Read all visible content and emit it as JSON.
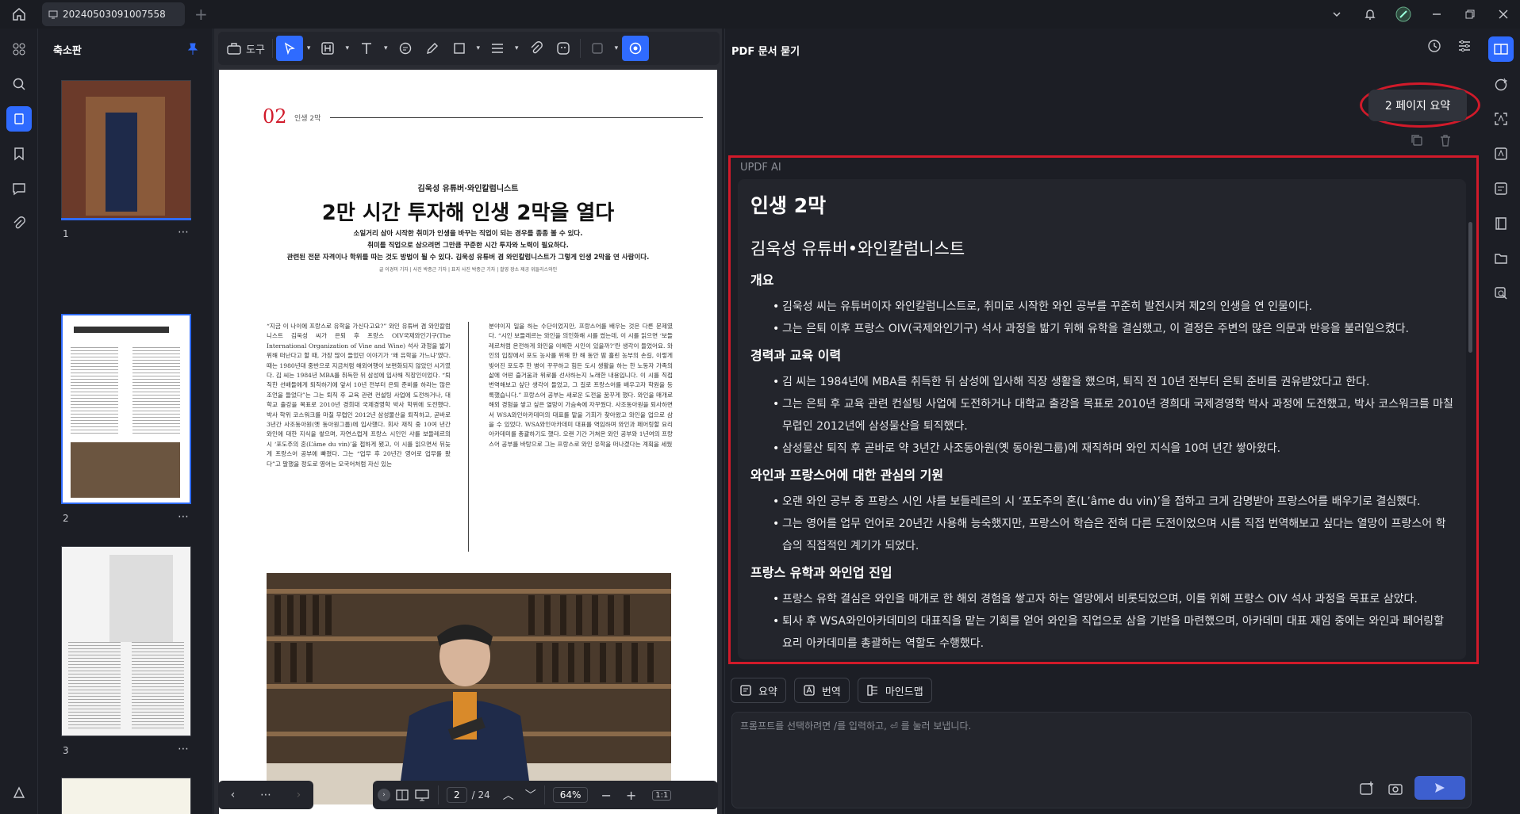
{
  "titlebar": {
    "tab_title": "20240503091007558"
  },
  "thumbnails": {
    "header": "축소판",
    "pages": [
      {
        "num": "1",
        "more": "⋯"
      },
      {
        "num": "2",
        "more": "⋯"
      },
      {
        "num": "3",
        "more": "⋯"
      }
    ]
  },
  "toolbar": {
    "tools_label": "도구"
  },
  "page": {
    "section_number": "02",
    "section_name": "인생 2막",
    "kicker": "김욱성 유튜버·와인칼럼니스트",
    "title": "2만 시간 투자해 인생 2막을 열다",
    "lead_1": "소일거리 삼아 시작한 취미가 인생을 바꾸는 직업이 되는 경우를 종종 볼 수 있다.",
    "lead_2": "취미를 직업으로 삼으려면 그만큼 꾸준한 시간 투자와 노력이 필요하다.",
    "lead_3": "관련된 전문 자격이나 학위를 따는 것도 방법이 될 수 있다. 김욱성 유튜버 겸 와인칼럼니스트가 그렇게 인생 2막을 연 사람이다.",
    "credit": "글 이경미 기자 | 사진 박종근 기자 | 표지 사진 박종근 기자 | 촬영 장소 제공 위들리스와인",
    "col_left": "“지금 이 나이에 프랑스로 유학을 가신다고요?” 와인 유튜버 겸 와인칼럼니스트 김욱성 씨가 은퇴 후 프랑스 OIV국제와인기구(The International Organization of Vine and Wine) 석사 과정을 밟기 위해 떠난다고 할 때, 가장 많이 들었던 이야기가 ‘왜 유학을 가느냐’였다. 때는 1980년대 중반으로 지금처럼 해외여행이 보편화되지 않았던 시기였다. 김 씨는 1984년 MBA를 취득한 뒤 삼성에 입사해 직장인이었다. “퇴직한 선배들에게 퇴직하기에 앞서 10년 전부터 은퇴 준비를 하라는 많은 조언을 들었다”는 그는 퇴직 후 교육 관련 컨설팅 사업에 도전하거나, 대학교 출강을 목표로 2010년 경희대 국제경영학 박사 학위에 도전했다. 박사 학위 코스워크를 마칠 무렵인 2012년 삼성물산을 퇴직하고, 곧바로 3년간 사조동아원(옛 동아원그룹)에 입사했다. 회사 재직 중 10여 년간 와인에 대한 지식을 쌓으며, 자연스럽게 프랑스 시인인 샤를 보들레르의 시 ‘포도주의 혼(L’âme du vin)’을 접하게 됐고, 이 시를 읽으면서 뒤늦게 프랑스어 공부에 빠졌다. 그는 “업무 후 20년간 영어로 업무를 봤다”고 말했을 정도로 영어는 모국어처럼 자신 있는",
    "col_right": "분야이지 일을 하는 수단이었지만, 프랑스어를 배우는 것은 다른 문제였다. “시인 보들레르는 와인을 의인화해 시를 썼는데, 이 시를 읽으면 ‘보들레르처럼 온전하게 와인을 이해한 시인이 있을까?’란 생각이 들었어요. 와인의 입장에서 포도 농사를 위해 한 해 동안 땀 흘린 농부의 손길, 이렇게 빚어진 포도주 한 병이 꾸꾸하고 힘든 도시 생활을 하는 한 노동자 가족의 삶에 어떤 즐거움과 위로를 선사하는지 노래한 내용입니다. 이 시를 직접 번역해보고 싶단 생각이 들었고, 그 길로 프랑스어를 배우고자 학원을 등록했습니다.” 프랑스어 공부는 새로운 도전을 꿈꾸게 했다. 와인을 매개로 해외 경험을 쌓고 싶은 열망이 가슴속에 자꾸웠다. 사조동아원을 퇴사하면서 WSA와인아카데미의 대표를 맡을 기회가 찾아왔고 와인을 업으로 삼을 수 있었다. WSA와인아카데미 대표를 역임하며 와인과 페어링할 요리 아카데미를 총괄하기도 했다. 오랜 기간 거쳐온 와인 공부와 1년여의 프랑스어 공부를 바탕으로 그는 프랑스로 와인 유학을 떠나겠다는 계획을 세웠"
  },
  "bottombar": {
    "page_current": "2",
    "page_total": "/ 24",
    "zoom": "64%",
    "fit": "1:1"
  },
  "ai_panel": {
    "title": "PDF 문서 묻기",
    "summary_button": "2 페이지 요약",
    "ai_label": "UPDF AI",
    "h1": "인생 2막",
    "h2": "김욱성 유튜버•와인칼럼니스트",
    "sections": [
      {
        "heading": "개요",
        "items": [
          "김욱성 씨는 유튜버이자 와인칼럼니스트로, 취미로 시작한 와인 공부를 꾸준히 발전시켜 제2의 인생을 연 인물이다.",
          "그는 은퇴 이후 프랑스 OIV(국제와인기구) 석사 과정을 밟기 위해 유학을 결심했고, 이 결정은 주변의 많은 의문과 반응을 불러일으켰다."
        ]
      },
      {
        "heading": "경력과 교육 이력",
        "items": [
          "김 씨는 1984년에 MBA를 취득한 뒤 삼성에 입사해 직장 생활을 했으며, 퇴직 전 10년 전부터 은퇴 준비를 권유받았다고 한다.",
          "그는 은퇴 후 교육 관련 컨설팅 사업에 도전하거나 대학교 출강을 목표로 2010년 경희대 국제경영학 박사 과정에 도전했고, 박사 코스워크를 마칠 무렵인 2012년에 삼성물산을 퇴직했다.",
          "삼성물산 퇴직 후 곧바로 약 3년간 사조동아원(옛 동아원그룹)에 재직하며 와인 지식을 10여 년간 쌓아왔다."
        ]
      },
      {
        "heading": "와인과 프랑스어에 대한 관심의 기원",
        "items": [
          "오랜 와인 공부 중 프랑스 시인 샤를 보들레르의 시 ‘포도주의 혼(L’âme du vin)’을 접하고 크게 감명받아 프랑스어를 배우기로 결심했다.",
          "그는 영어를 업무 언어로 20년간 사용해 능숙했지만, 프랑스어 학습은 전혀 다른 도전이었으며 시를 직접 번역해보고 싶다는 열망이 프랑스어 학습의 직접적인 계기가 되었다."
        ]
      },
      {
        "heading": "프랑스 유학과 와인업 진입",
        "items": [
          "프랑스 유학 결심은 와인을 매개로 한 해외 경험을 쌓고자 하는 열망에서 비롯되었으며, 이를 위해 프랑스 OIV 석사 과정을 목표로 삼았다.",
          "퇴사 후 WSA와인아카데미의 대표직을 맡는 기회를 얻어 와인을 직업으로 삼을 기반을 마련했으며, 아카데미 대표 재임 중에는 와인과 페어링할 요리 아카데미를 총괄하는 역할도 수행했다."
        ]
      }
    ],
    "chips": [
      "요약",
      "번역",
      "마인드맵"
    ],
    "input_placeholder": "프롬프트를 선택하려면 /를 입력하고, ⏎ 를 눌러 보냅니다."
  },
  "colors": {
    "accent": "#2f6bff",
    "highlight": "#d11a2a"
  }
}
